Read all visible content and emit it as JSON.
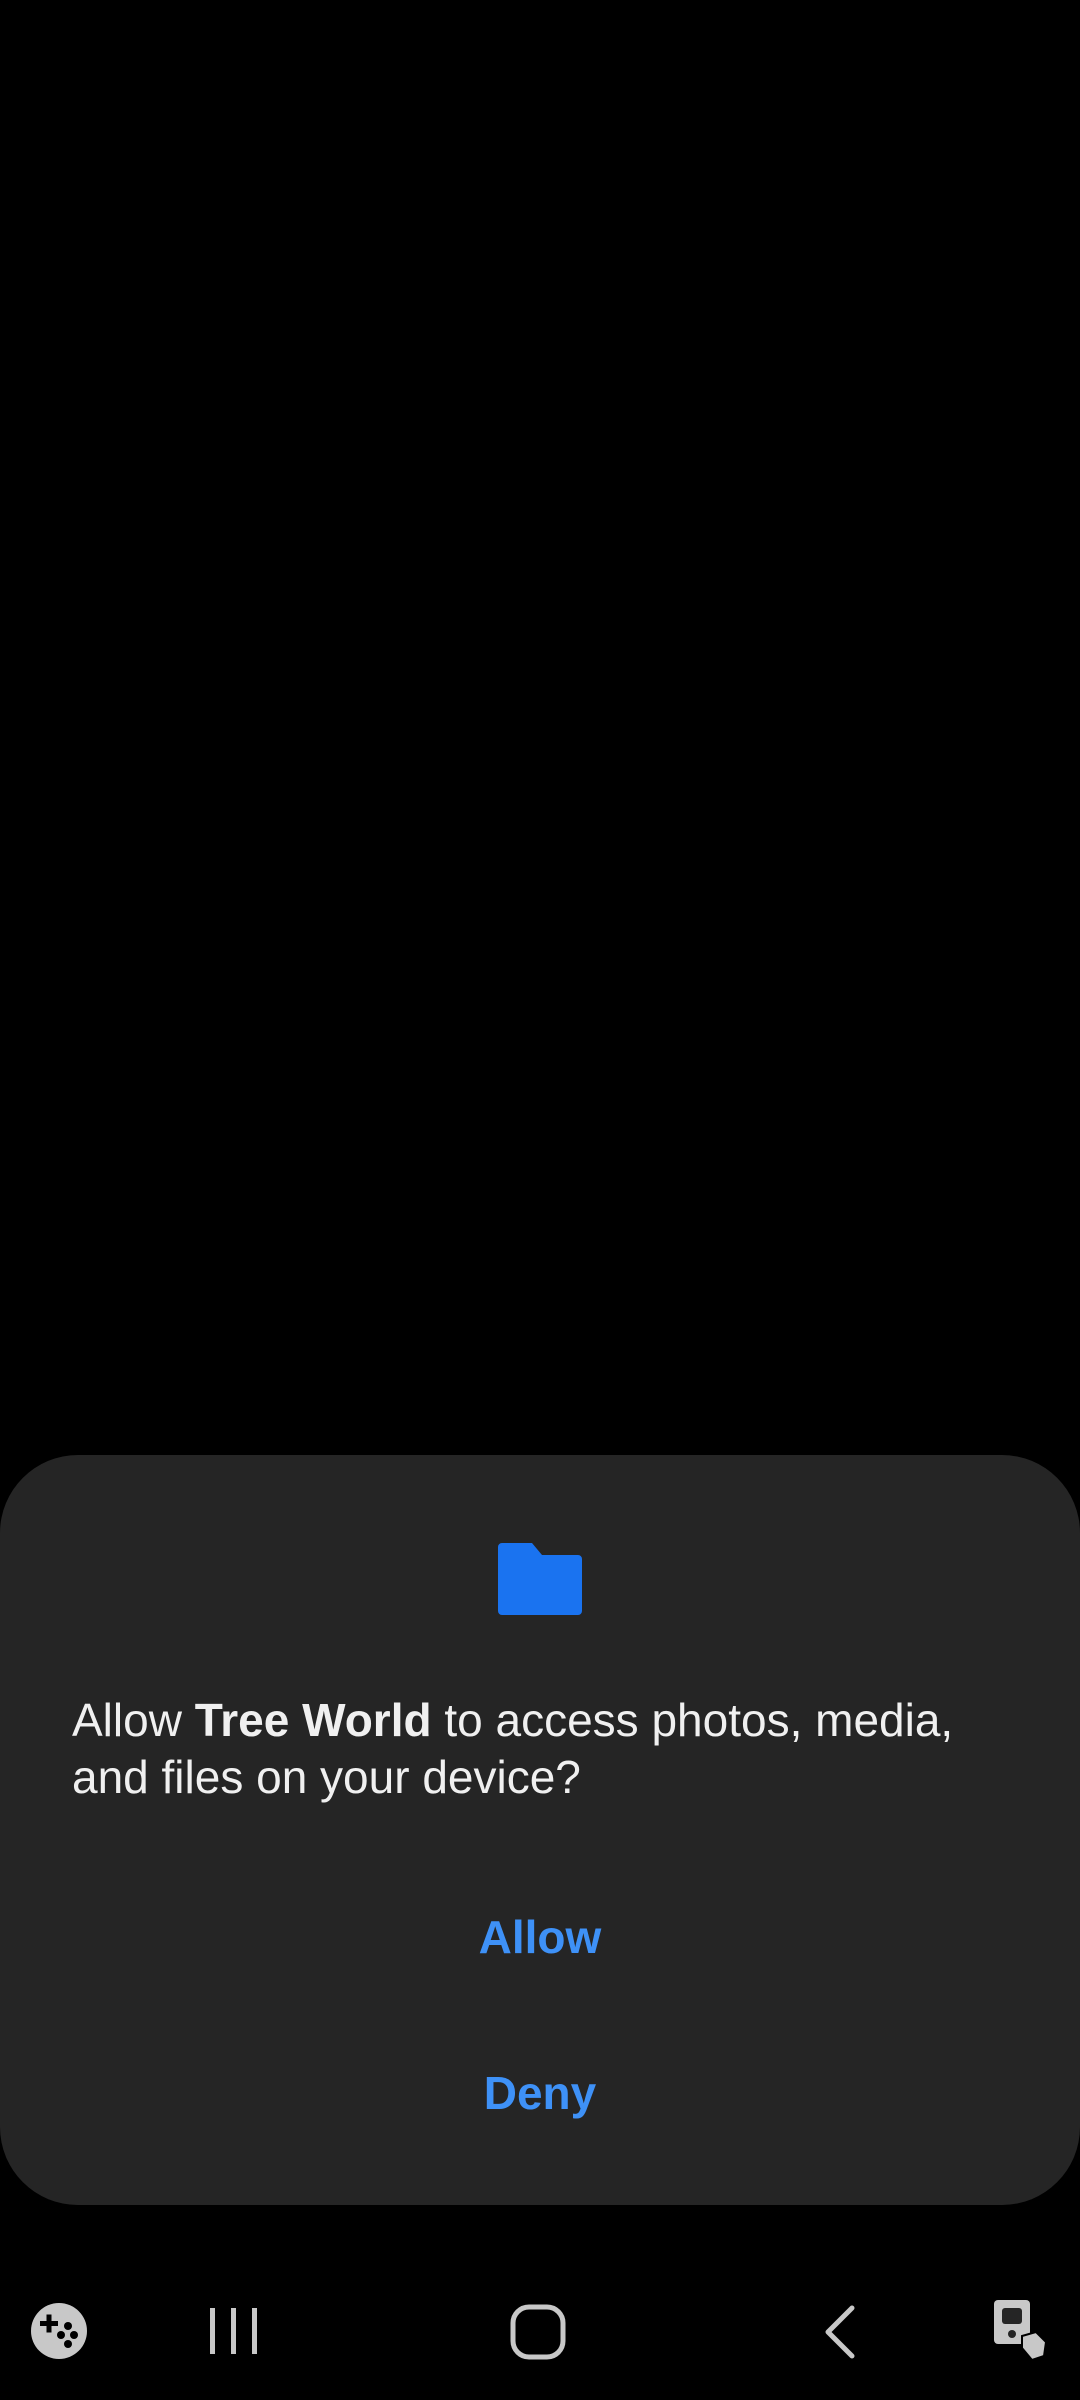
{
  "dialog": {
    "icon": "folder-icon",
    "message_prefix": "Allow ",
    "app_name": "Tree World",
    "message_suffix": " to access photos, media, and files on your device?",
    "allow_label": "Allow",
    "deny_label": "Deny"
  },
  "navbar": {
    "icons": [
      "game-tools-icon",
      "recent-apps-icon",
      "home-icon",
      "back-icon",
      "accessibility-touch-icon"
    ]
  },
  "colors": {
    "background": "#000000",
    "dialog_background": "#252525",
    "accent": "#3e91f7",
    "folder": "#1a73f0",
    "text": "#f0f0f0",
    "nav_icon": "#c8c8c8"
  }
}
